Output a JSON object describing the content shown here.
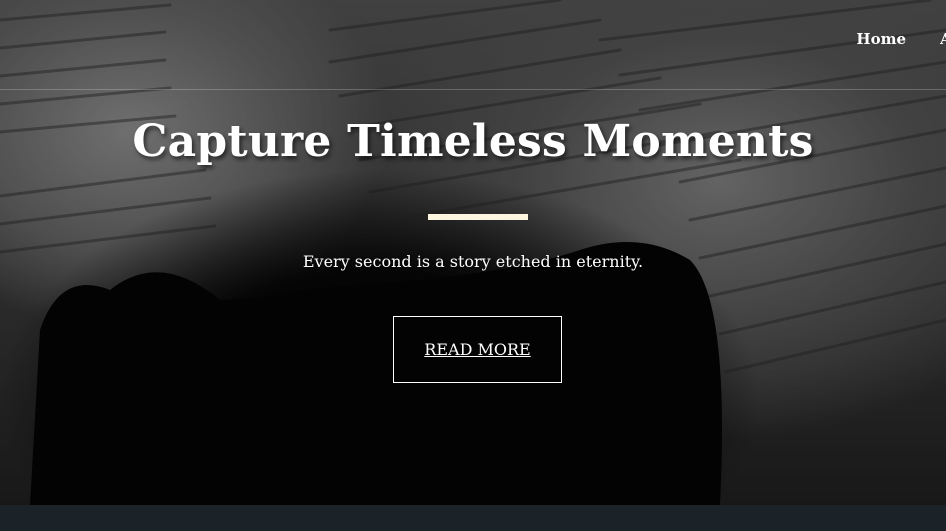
{
  "nav": {
    "items": [
      {
        "label": "Home"
      },
      {
        "label": "A"
      }
    ]
  },
  "hero": {
    "title": "Capture Timeless Moments",
    "subtitle": "Every second is a story etched in eternity.",
    "cta_label": "READ MORE",
    "accent_color": "#fdf5dd"
  }
}
